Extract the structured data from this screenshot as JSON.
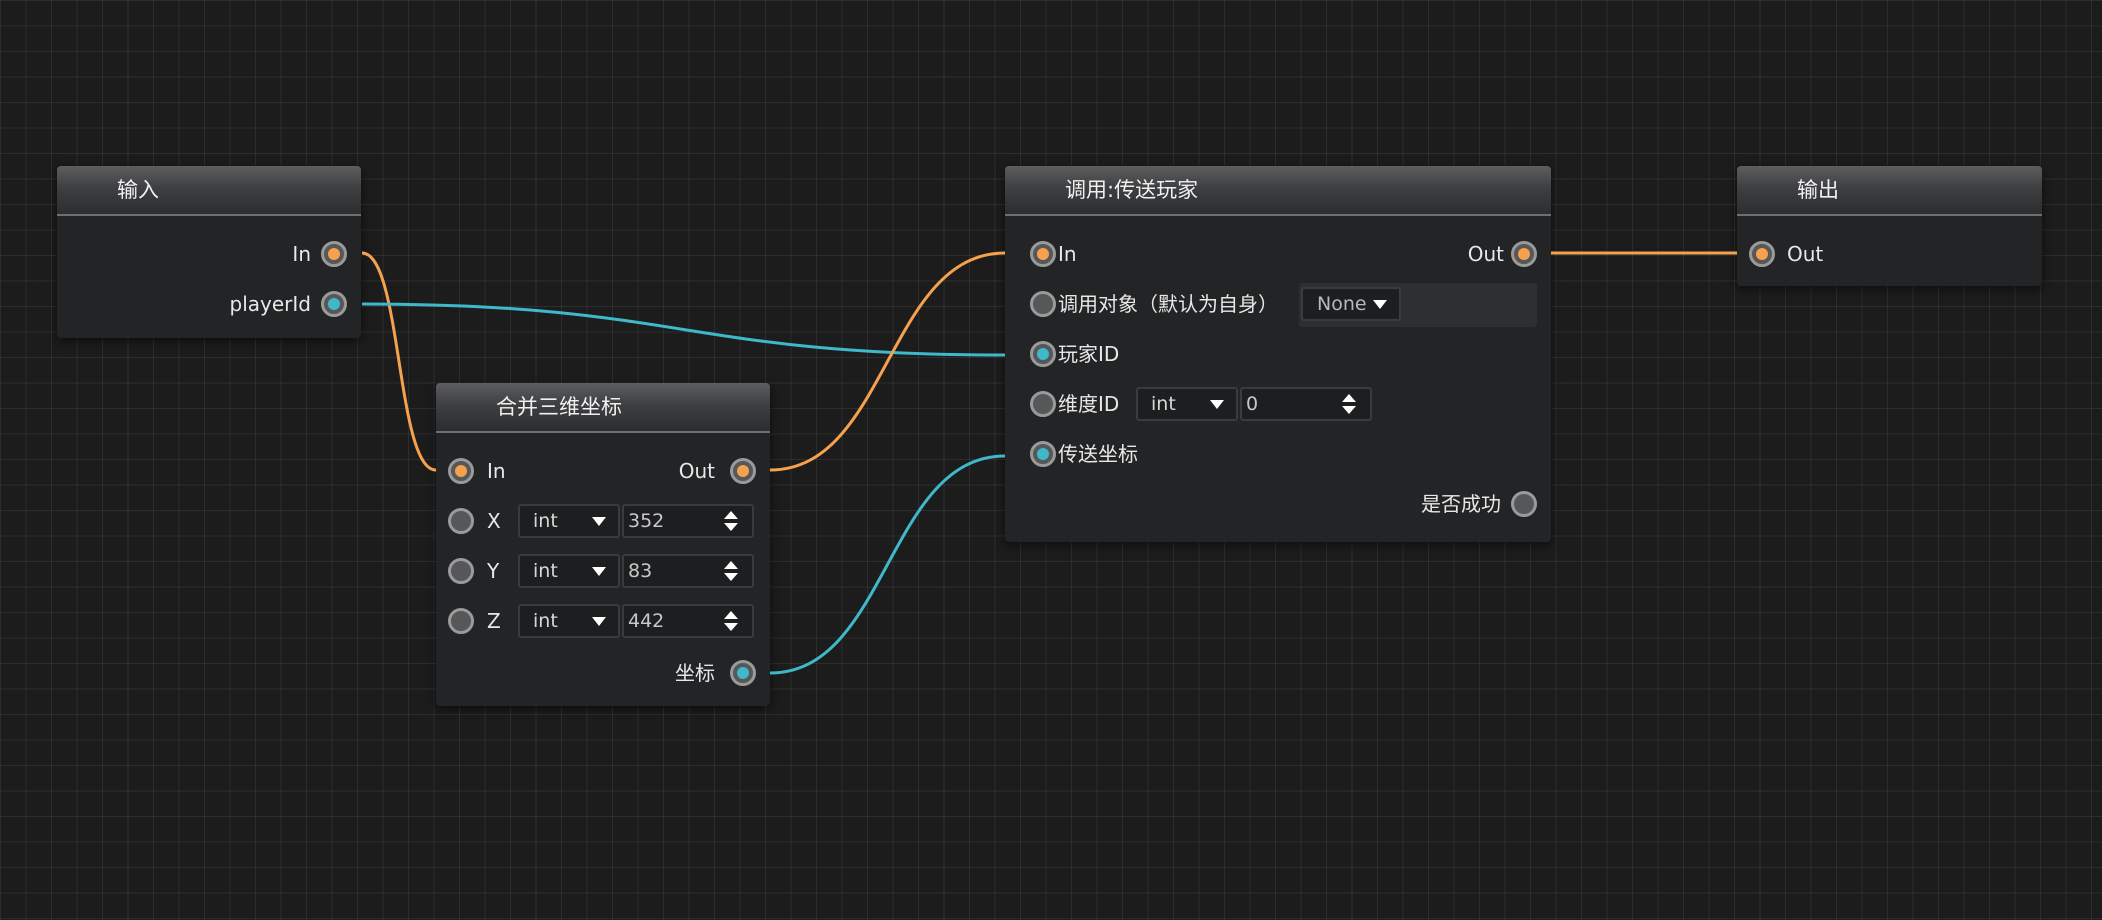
{
  "wire_colors": {
    "exec": "#f5a14e",
    "data": "#3fb8c9"
  },
  "nodes": {
    "input": {
      "title": "输入",
      "outputs": [
        {
          "label": "In",
          "kind": "exec"
        },
        {
          "label": "playerId",
          "kind": "data"
        }
      ]
    },
    "merge": {
      "title": "合并三维坐标",
      "in_label": "In",
      "out_label": "Out",
      "x": {
        "label": "X",
        "type": "int",
        "value": "352"
      },
      "y": {
        "label": "Y",
        "type": "int",
        "value": "83"
      },
      "z": {
        "label": "Z",
        "type": "int",
        "value": "442"
      },
      "coord_label": "坐标"
    },
    "call": {
      "title": "调用:传送玩家",
      "in_label": "In",
      "out_label": "Out",
      "target_label": "调用对象（默认为自身）",
      "target_value": "None",
      "player_label": "玩家ID",
      "dim_label": "维度ID",
      "dim_type": "int",
      "dim_value": "0",
      "teleport_label": "传送坐标",
      "success_label": "是否成功"
    },
    "output": {
      "title": "输出",
      "in_label": "Out"
    }
  }
}
